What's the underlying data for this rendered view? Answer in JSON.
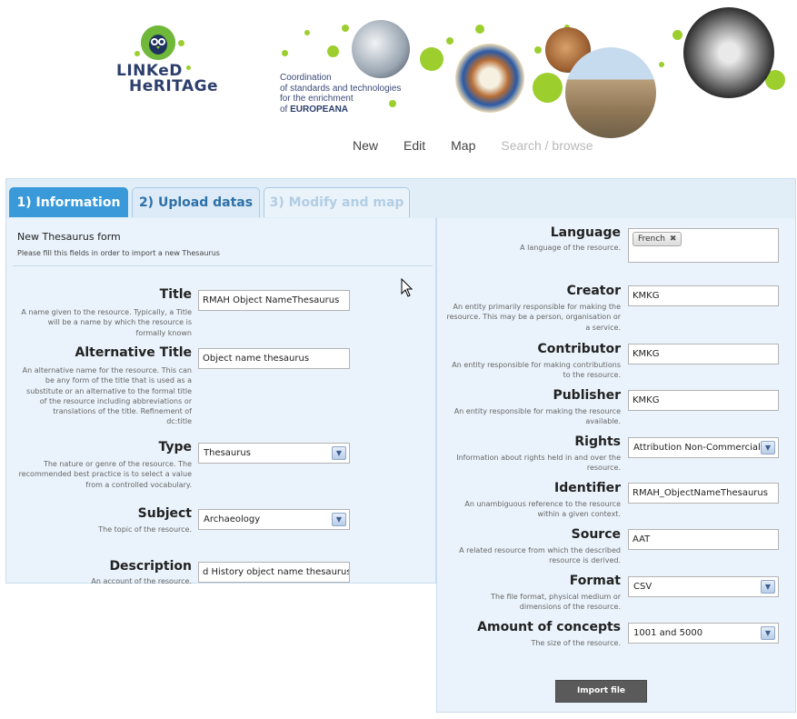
{
  "banner": {
    "logo_line1": "LINKeD",
    "logo_line2": "HeRITAGe",
    "tagline": [
      "Coordination",
      "of standards and technologies",
      "for the enrichment",
      "of "
    ],
    "tagline_strong": "EUROPEANA",
    "accent_color": "#9ccf2e"
  },
  "nav": {
    "items": [
      {
        "label": "New"
      },
      {
        "label": "Edit"
      },
      {
        "label": "Map"
      },
      {
        "label": "Search / browse"
      }
    ]
  },
  "tabs": [
    {
      "label": "1) Information",
      "state": "active"
    },
    {
      "label": "2) Upload datas",
      "state": "enabled"
    },
    {
      "label": "3) Modify and map",
      "state": "disabled"
    }
  ],
  "form": {
    "title": "New Thesaurus form",
    "subtitle": "Please fill this fields in order to import a new Thesaurus"
  },
  "left_fields": [
    {
      "label": "Title",
      "description": [
        "A name given to the resource. Typically, a Title",
        "will be a name by which the resource is",
        "formally known"
      ],
      "value": "RMAH Object NameThesaurus",
      "kind": "text"
    },
    {
      "label": "Alternative Title",
      "description": [
        "An alternative name for the resource. This can",
        "be any form of the title that is used as a",
        "substitute or an alternative to the formal title",
        "of the resource including abbreviations or",
        "translations of the title. Refinement of",
        "dc:title"
      ],
      "value": "Object name thesaurus",
      "kind": "text"
    },
    {
      "label": "Type",
      "description": [
        "The nature or genre of the resource. The",
        "recommended best practice is to select a value",
        "from a controlled vocabulary."
      ],
      "value": "Thesaurus",
      "kind": "select"
    },
    {
      "label": "Subject",
      "description": [
        "The topic of the resource."
      ],
      "value": "Archaeology",
      "kind": "select"
    },
    {
      "label": "Description",
      "description": [
        "An account of the resource."
      ],
      "value": "d History object name thesaurus",
      "kind": "text"
    }
  ],
  "right_fields": [
    {
      "label": "Language",
      "description": [
        "A language of the resource."
      ],
      "value": "French",
      "kind": "tags"
    },
    {
      "label": "Creator",
      "description": [
        "An entity primarily responsible for making the",
        "resource. This may be a person, organisation or",
        "a service."
      ],
      "value": "KMKG",
      "kind": "text"
    },
    {
      "label": "Contributor",
      "description": [
        "An entity responsible for making contributions",
        "to the resource."
      ],
      "value": "KMKG",
      "kind": "text"
    },
    {
      "label": "Publisher",
      "description": [
        "An entity responsible for making the resource",
        "available."
      ],
      "value": "KMKG",
      "kind": "text"
    },
    {
      "label": "Rights",
      "description": [
        "Information about rights held in and over the",
        "resource."
      ],
      "value": "Attribution Non-Commercial",
      "kind": "select"
    },
    {
      "label": "Identifier",
      "description": [
        "An unambiguous reference to the resource",
        "within a given context."
      ],
      "value": "RMAH_ObjectNameThesaurus",
      "kind": "text"
    },
    {
      "label": "Source",
      "description": [
        "A related resource from which the described",
        "resource is derived."
      ],
      "value": "AAT",
      "kind": "text"
    },
    {
      "label": "Format",
      "description": [
        "The file format, physical medium or",
        "dimensions of the resource."
      ],
      "value": "CSV",
      "kind": "select"
    },
    {
      "label": "Amount of concepts",
      "description": [
        "The size of the resource."
      ],
      "value": "1001 and 5000",
      "kind": "select"
    }
  ],
  "import_button": "Import file",
  "icons": {
    "select_arrow": "chevron-down-icon",
    "tag_remove": "close-icon",
    "cursor": "mouse-pointer-icon"
  }
}
